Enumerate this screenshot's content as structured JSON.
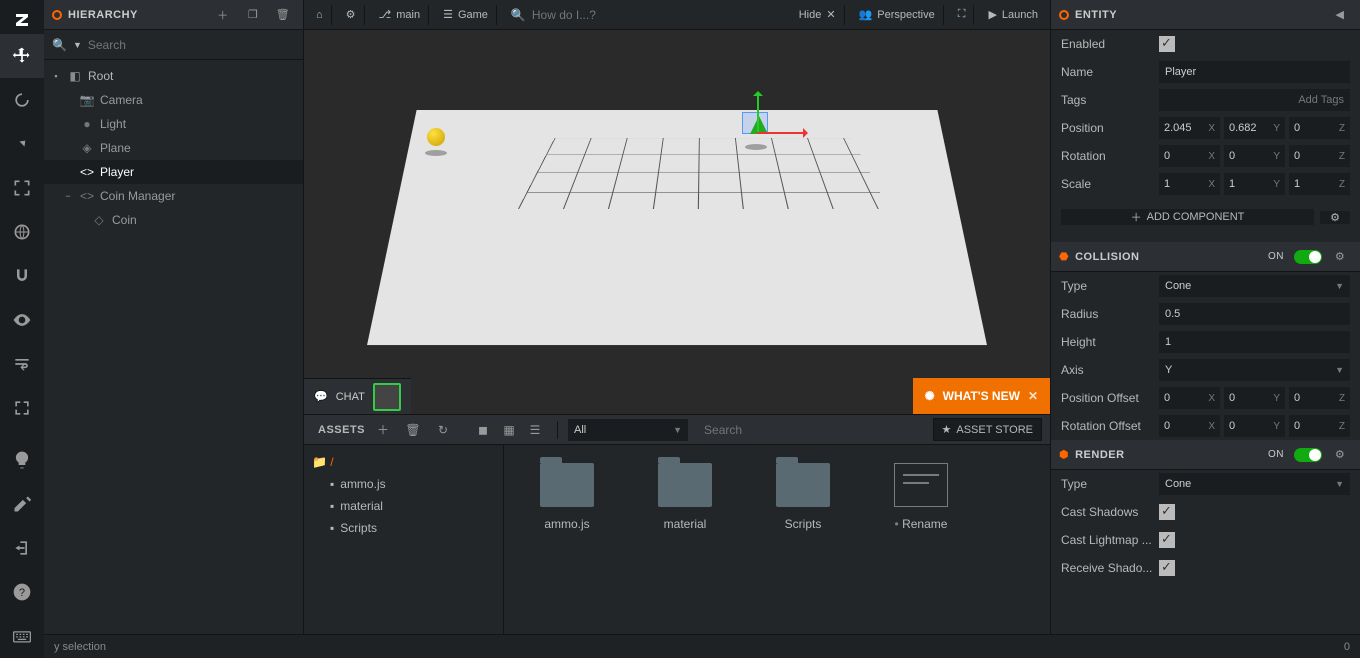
{
  "hierarchy": {
    "title": "HIERARCHY",
    "search_placeholder": "Search",
    "root": "Root",
    "items": [
      "Camera",
      "Light",
      "Plane",
      "Player",
      "Coin Manager",
      "Coin"
    ],
    "selected": "Player"
  },
  "topbar": {
    "branch": "main",
    "scene": "Game",
    "search_placeholder": "How do I...?",
    "hide": "Hide",
    "perspective": "Perspective",
    "launch": "Launch"
  },
  "chat": {
    "label": "CHAT"
  },
  "whatsnew": {
    "label": "WHAT'S NEW"
  },
  "assets": {
    "title": "ASSETS",
    "filter": "All",
    "search_placeholder": "Search",
    "store": "ASSET STORE",
    "crumb": "/",
    "folders": [
      "ammo.js",
      "material",
      "Scripts"
    ],
    "grid": [
      {
        "name": "ammo.js",
        "type": "folder"
      },
      {
        "name": "material",
        "type": "folder"
      },
      {
        "name": "Scripts",
        "type": "folder"
      },
      {
        "name": "Rename",
        "type": "rename"
      }
    ]
  },
  "entity": {
    "title": "ENTITY",
    "enabled_label": "Enabled",
    "enabled": true,
    "name_label": "Name",
    "name": "Player",
    "tags_label": "Tags",
    "tags_placeholder": "Add Tags",
    "position_label": "Position",
    "position": {
      "x": "2.045",
      "y": "0.682",
      "z": "0"
    },
    "rotation_label": "Rotation",
    "rotation": {
      "x": "0",
      "y": "0",
      "z": "0"
    },
    "scale_label": "Scale",
    "scale": {
      "x": "1",
      "y": "1",
      "z": "1"
    },
    "add_component": "ADD COMPONENT"
  },
  "collision": {
    "title": "COLLISION",
    "on": "ON",
    "type_label": "Type",
    "type": "Cone",
    "radius_label": "Radius",
    "radius": "0.5",
    "height_label": "Height",
    "height": "1",
    "axis_label": "Axis",
    "axis": "Y",
    "poff_label": "Position Offset",
    "poff": {
      "x": "0",
      "y": "0",
      "z": "0"
    },
    "roff_label": "Rotation Offset",
    "roff": {
      "x": "0",
      "y": "0",
      "z": "0"
    }
  },
  "render": {
    "title": "RENDER",
    "on": "ON",
    "type_label": "Type",
    "type": "Cone",
    "cast_shadows_label": "Cast Shadows",
    "cast_lightmap_label": "Cast Lightmap ...",
    "receive_shadow_label": "Receive Shado..."
  },
  "status": {
    "left": "y selection",
    "right": "0"
  }
}
